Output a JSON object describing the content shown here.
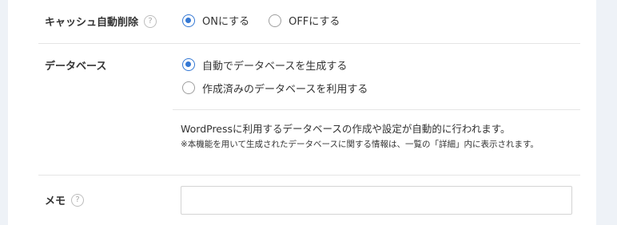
{
  "cache_auto_delete": {
    "label": "キャッシュ自動削除",
    "help": "?",
    "options": [
      {
        "label": "ONにする",
        "checked": true
      },
      {
        "label": "OFFにする",
        "checked": false
      }
    ]
  },
  "database": {
    "label": "データベース",
    "options": [
      {
        "label": "自動でデータベースを生成する",
        "checked": true
      },
      {
        "label": "作成済みのデータベースを利用する",
        "checked": false
      }
    ],
    "description": "WordPressに利用するデータベースの作成や設定が自動的に行われます。",
    "note": "※本機能を用いて生成されたデータベースに関する情報は、一覧の「詳細」内に表示されます。"
  },
  "memo": {
    "label": "メモ",
    "help": "?",
    "value": ""
  },
  "colors": {
    "accent": "#3478d4",
    "background": "#eef2f7",
    "divider": "#e5e5e5"
  }
}
